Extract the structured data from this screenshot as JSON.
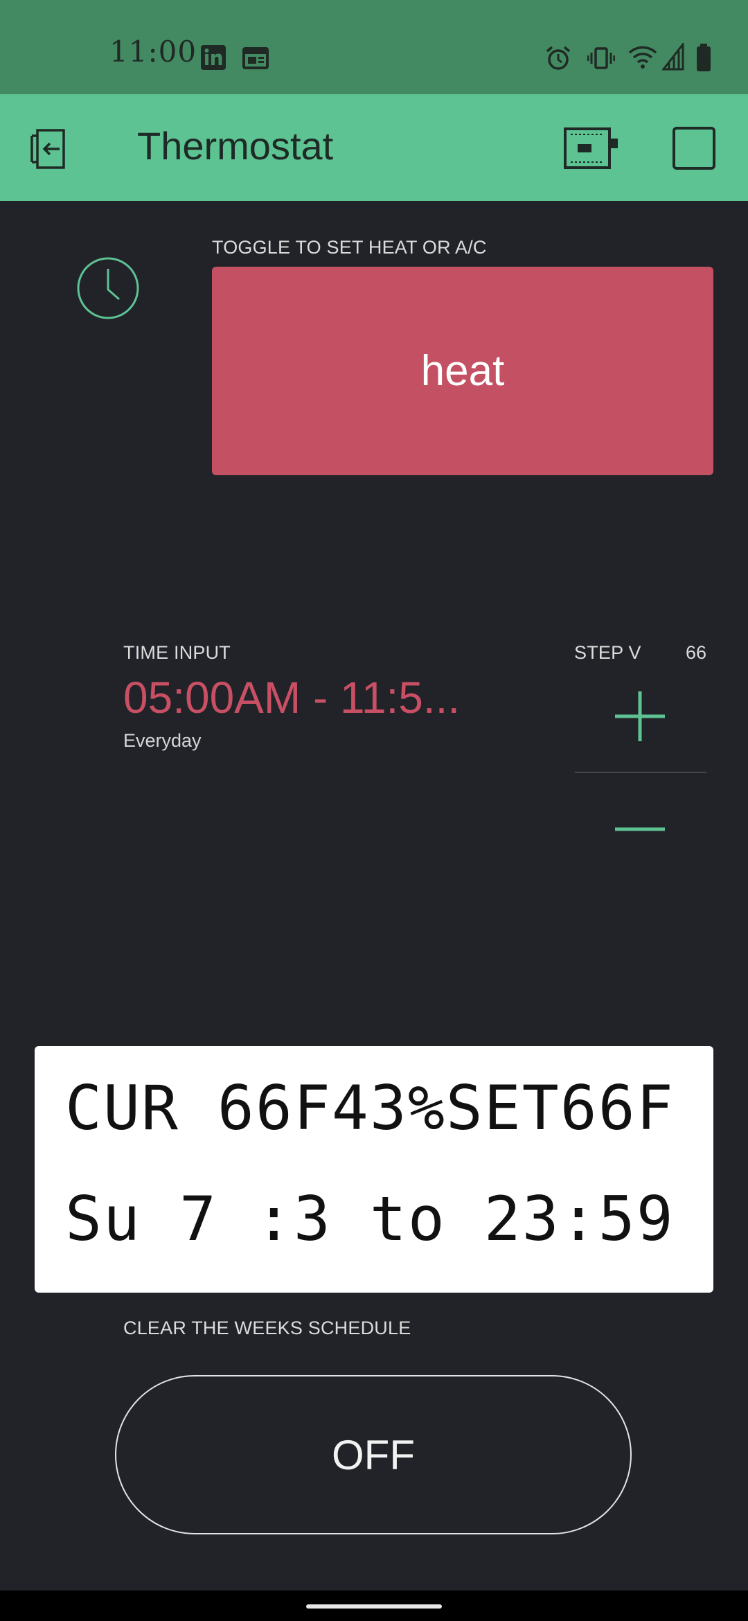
{
  "status_bar": {
    "time": "11:00",
    "left_icons": [
      "linkedin-icon",
      "calendar-icon"
    ],
    "right_icons": [
      "alarm-icon",
      "vibrate-icon",
      "wifi-icon",
      "signal-icon",
      "battery-icon"
    ]
  },
  "app_bar": {
    "title": "Thermostat",
    "icons": [
      "exit-icon",
      "device-icon",
      "square-icon"
    ],
    "background_color": "#5ec393"
  },
  "toggle": {
    "label": "TOGGLE TO SET HEAT OR A/C",
    "value": "heat",
    "color": "#c35163"
  },
  "time_input": {
    "label": "TIME INPUT",
    "value": "05:00AM - 11:5...",
    "days": "Everyday"
  },
  "step": {
    "label": "STEP V",
    "value": "66"
  },
  "lcd": {
    "line1": "CUR 66F43%SET66F",
    "line2": "Su 7 :3 to 23:59"
  },
  "clear_schedule": {
    "label": "CLEAR THE WEEKS SCHEDULE",
    "button_label": "OFF"
  },
  "accent_color": "#5ec393"
}
